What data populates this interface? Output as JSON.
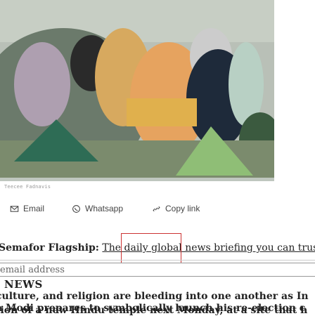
{
  "hero": {
    "caption": "Teecee Fadnavis"
  },
  "share": {
    "email_label": "Email",
    "whatsapp_label": "Whatsapp",
    "copy_label": "Copy link"
  },
  "promo": {
    "name": "Semafor Flagship:",
    "description": "The daily global news briefing you can trust."
  },
  "email": {
    "placeholder": "email address"
  },
  "news": {
    "heading": "NEWS",
    "lines": [
      "culture, and religion are bleeding into one another as In",
      "a Modi prepares to symbolically launch his re-election c",
      "tion of a new Hindu temple next Monday, at a site that h"
    ]
  }
}
